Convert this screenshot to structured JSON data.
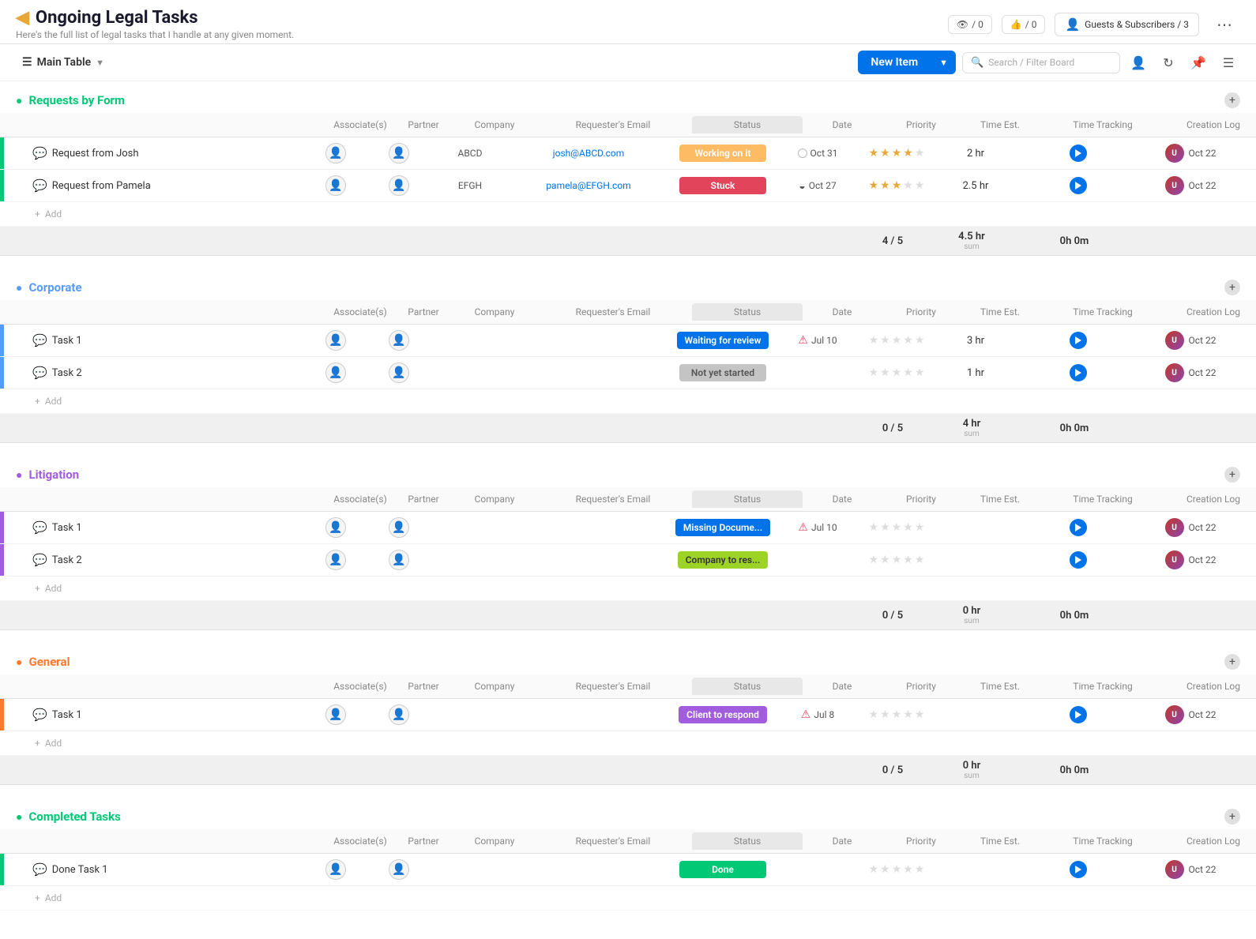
{
  "app": {
    "title": "Ongoing Legal Tasks",
    "subtitle": "Here's the full list of legal tasks that I handle at any given moment.",
    "views_count": "0",
    "likes_count": "0",
    "guests_label": "Guests & Subscribers / 3"
  },
  "toolbar": {
    "main_table_label": "Main Table",
    "new_item_label": "New Item",
    "search_placeholder": "Search / Filter Board"
  },
  "columns": {
    "associates": "Associate(s)",
    "partner": "Partner",
    "company": "Company",
    "requester_email": "Requester's Email",
    "status": "Status",
    "date": "Date",
    "priority": "Priority",
    "time_est": "Time Est.",
    "time_tracking": "Time Tracking",
    "creation_log": "Creation Log"
  },
  "groups": [
    {
      "id": "requests_by_form",
      "title": "Requests by Form",
      "color": "green",
      "color_hex": "#00c875",
      "rows": [
        {
          "name": "Request from Josh",
          "company": "ABCD",
          "requester_email": "josh@ABCD.com",
          "status": "Working on it",
          "status_class": "status-working",
          "date": "Oct 31",
          "date_indicator": "circle",
          "stars_filled": 4,
          "stars_total": 5,
          "time_est": "2 hr",
          "creation_date": "Oct 22"
        },
        {
          "name": "Request from Pamela",
          "company": "EFGH",
          "requester_email": "pamela@EFGH.com",
          "status": "Stuck",
          "status_class": "status-stuck",
          "date": "Oct 27",
          "date_indicator": "half",
          "stars_filled": 3,
          "stars_total": 5,
          "time_est": "2.5 hr",
          "creation_date": "Oct 22"
        }
      ],
      "summary": {
        "priority": "4 / 5",
        "time_est": "4.5 hr",
        "time_est_label": "sum",
        "time_tracking": "0h 0m"
      }
    },
    {
      "id": "corporate",
      "title": "Corporate",
      "color": "blue",
      "color_hex": "#579bfc",
      "rows": [
        {
          "name": "Task 1",
          "company": "",
          "requester_email": "",
          "status": "Waiting for review",
          "status_class": "status-waiting",
          "date": "Jul 10",
          "date_indicator": "alert",
          "stars_filled": 0,
          "stars_total": 5,
          "time_est": "3 hr",
          "creation_date": "Oct 22"
        },
        {
          "name": "Task 2",
          "company": "",
          "requester_email": "",
          "status": "Not yet started",
          "status_class": "status-not-started",
          "date": "",
          "date_indicator": "",
          "stars_filled": 0,
          "stars_total": 5,
          "time_est": "1 hr",
          "creation_date": "Oct 22"
        }
      ],
      "summary": {
        "priority": "0 / 5",
        "time_est": "4 hr",
        "time_est_label": "sum",
        "time_tracking": "0h 0m"
      }
    },
    {
      "id": "litigation",
      "title": "Litigation",
      "color": "purple",
      "color_hex": "#a25ddc",
      "rows": [
        {
          "name": "Task 1",
          "company": "",
          "requester_email": "",
          "status": "Missing Docume...",
          "status_class": "status-missing",
          "date": "Jul 10",
          "date_indicator": "alert",
          "stars_filled": 0,
          "stars_total": 5,
          "time_est": "",
          "creation_date": "Oct 22"
        },
        {
          "name": "Task 2",
          "company": "",
          "requester_email": "",
          "status": "Company to res...",
          "status_class": "status-company",
          "date": "",
          "date_indicator": "",
          "stars_filled": 0,
          "stars_total": 5,
          "time_est": "",
          "creation_date": "Oct 22"
        }
      ],
      "summary": {
        "priority": "0 / 5",
        "time_est": "0 hr",
        "time_est_label": "sum",
        "time_tracking": "0h 0m"
      }
    },
    {
      "id": "general",
      "title": "General",
      "color": "orange",
      "color_hex": "#ff7830",
      "rows": [
        {
          "name": "Task 1",
          "company": "",
          "requester_email": "",
          "status": "Client to respond",
          "status_class": "status-client",
          "date": "Jul 8",
          "date_indicator": "alert",
          "stars_filled": 0,
          "stars_total": 5,
          "time_est": "",
          "creation_date": "Oct 22"
        }
      ],
      "summary": {
        "priority": "0 / 5",
        "time_est": "0 hr",
        "time_est_label": "sum",
        "time_tracking": "0h 0m"
      }
    },
    {
      "id": "completed_tasks",
      "title": "Completed Tasks",
      "color": "green",
      "color_hex": "#00c875",
      "rows": [
        {
          "name": "Done Task 1",
          "company": "",
          "requester_email": "",
          "status": "Done",
          "status_class": "status-done",
          "date": "",
          "date_indicator": "",
          "stars_filled": 0,
          "stars_total": 5,
          "time_est": "",
          "creation_date": "Oct 22"
        }
      ],
      "summary": null
    }
  ]
}
